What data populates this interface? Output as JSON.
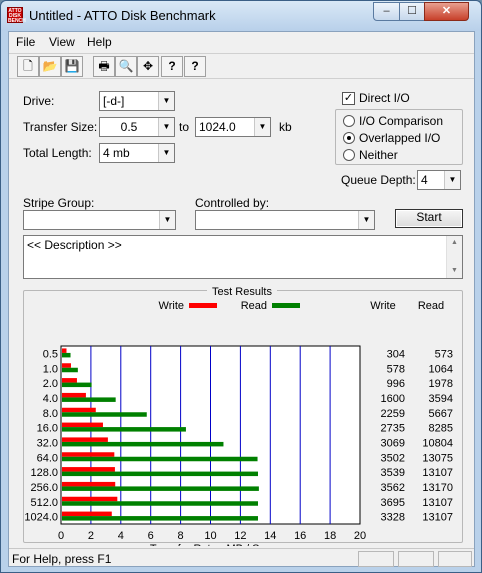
{
  "window": {
    "title": "Untitled - ATTO Disk Benchmark",
    "icon_text": "ATTO DISK BENCH",
    "controls": [
      "minimize-icon",
      "maximize-icon",
      "close-icon"
    ],
    "min_glyph": "‒",
    "max_glyph": "☐",
    "close_glyph": "✕"
  },
  "menu": [
    {
      "label": "File",
      "key": "F"
    },
    {
      "label": "View",
      "key": "V"
    },
    {
      "label": "Help",
      "key": "H"
    }
  ],
  "toolbar": {
    "buttons": [
      "new-icon",
      "open-icon",
      "save-icon",
      "print-icon",
      "print-preview-icon",
      "move-icon",
      "help-icon",
      "context-help-icon"
    ],
    "glyphs": [
      "🗋",
      "📂",
      "💾",
      "🖶",
      "🔍",
      "✥",
      "?",
      "?"
    ]
  },
  "form": {
    "drive_label": "Drive:",
    "drive_value": "[-d-]",
    "transfer_size_label": "Transfer Size:",
    "transfer_from": "0.5",
    "transfer_to_label": "to",
    "transfer_to": "1024.0",
    "transfer_unit": "kb",
    "total_length_label": "Total Length:",
    "total_length_value": "4 mb",
    "direct_io_label": "Direct I/O",
    "direct_io_checked": true,
    "io_comparison_label": "I/O Comparison",
    "overlapped_io_label": "Overlapped I/O",
    "neither_label": "Neither",
    "selected_mode": "Overlapped I/O",
    "queue_depth_label": "Queue Depth:",
    "queue_depth_value": "4",
    "stripe_group_label": "Stripe Group:",
    "stripe_group_value": "",
    "controlled_by_label": "Controlled by:",
    "controlled_by_value": "",
    "start_label": "Start",
    "description": "<< Description >>",
    "check_glyph": "✓",
    "arrow_glyph": "▼",
    "up_glyph": "▲"
  },
  "results": {
    "title": "Test Results",
    "legend_write": "Write",
    "legend_read": "Read",
    "col_write": "Write",
    "col_read": "Read",
    "write_color": "#ff0000",
    "read_color": "#008000",
    "grid_color": "#0000c8"
  },
  "chart_data": {
    "type": "bar",
    "orientation": "horizontal",
    "title": "Test Results",
    "xlabel": "Transfer Rate - MB / Sec",
    "ylabel": "",
    "xlim": [
      0,
      20
    ],
    "xticks": [
      0,
      2,
      4,
      6,
      8,
      10,
      12,
      14,
      16,
      18,
      20
    ],
    "grid": true,
    "legend": "top",
    "categories": [
      "0.5",
      "1.0",
      "2.0",
      "4.0",
      "8.0",
      "16.0",
      "32.0",
      "64.0",
      "128.0",
      "256.0",
      "512.0",
      "1024.0"
    ],
    "series": [
      {
        "name": "Write",
        "color": "#ff0000",
        "values": [
          0.3,
          0.6,
          1.0,
          1.6,
          2.26,
          2.74,
          3.07,
          3.5,
          3.54,
          3.56,
          3.7,
          3.33
        ]
      },
      {
        "name": "Read",
        "color": "#008000",
        "values": [
          0.57,
          1.06,
          1.98,
          3.59,
          5.67,
          8.29,
          10.8,
          13.08,
          13.11,
          13.17,
          13.11,
          13.11
        ]
      }
    ],
    "table": {
      "write": [
        "304",
        "578",
        "996",
        "1600",
        "2259",
        "2735",
        "3069",
        "3502",
        "3539",
        "3562",
        "3695",
        "3328"
      ],
      "read": [
        "573",
        "1064",
        "1978",
        "3594",
        "5667",
        "8285",
        "10804",
        "13075",
        "13107",
        "13170",
        "13107",
        "13107"
      ]
    }
  },
  "status": {
    "text": "For Help, press F1"
  }
}
